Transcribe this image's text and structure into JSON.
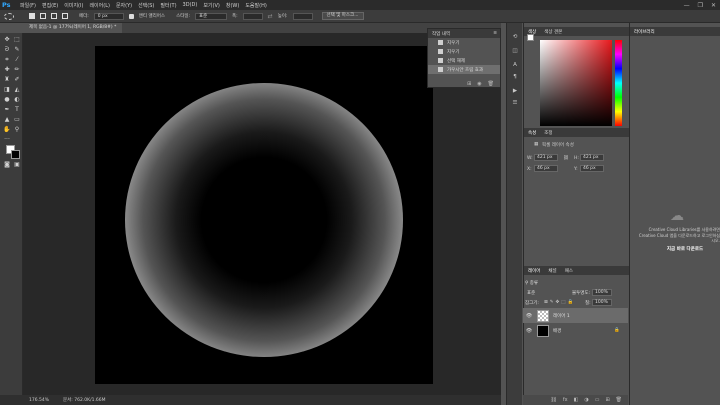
{
  "app": {
    "logo": "Ps"
  },
  "menu": [
    "파일(F)",
    "편집(E)",
    "이미지(I)",
    "레이어(L)",
    "문자(Y)",
    "선택(S)",
    "필터(T)",
    "3D(D)",
    "보기(V)",
    "창(W)",
    "도움말(H)"
  ],
  "window_controls": [
    "—",
    "❐",
    "✕"
  ],
  "options": {
    "feather_label": "페더:",
    "feather_value": "0 px",
    "antialias_label": "앤티 앨리어스",
    "style_label": "스타일:",
    "style_value": "표준",
    "width_label": "폭:",
    "height_label": "높이:",
    "select_mask_label": "선택 및 마스크..."
  },
  "document": {
    "tab_label": "제목 없음-1 @ 177%(레이어 1, RGB/8#) *",
    "zoom": "176.54%",
    "doc_info": "문서: 762.0K/1.66M"
  },
  "history": {
    "title": "작업 내역",
    "items": [
      {
        "label": "지우기",
        "selected": false
      },
      {
        "label": "지우기",
        "selected": false
      },
      {
        "label": "선택 해제",
        "selected": false
      },
      {
        "label": "가우시안 흐림 효과",
        "selected": true
      }
    ]
  },
  "color_panel": {
    "tabs": [
      "색상",
      "색상 견본"
    ]
  },
  "properties_panel": {
    "tabs": [
      "속성",
      "조정"
    ],
    "subtitle": "픽셀 레이어 속성",
    "w_label": "W:",
    "w_value": "421 px",
    "h_label": "H:",
    "h_value": "421 px",
    "x_label": "X:",
    "x_value": "46 px",
    "y_label": "Y:",
    "y_value": "46 px",
    "link_icon": "link-icon"
  },
  "libraries_panel": {
    "title": "라이브러리",
    "message": "Creative Cloud Libraries를 사용하려면 Creative Cloud 앱을 다운로드하고 로그인하십시오.",
    "download_link": "지금 바로 다운로드"
  },
  "layers_panel": {
    "tabs": [
      "레이어",
      "채널",
      "패스"
    ],
    "filter_label": "종류",
    "blend_mode": "표준",
    "opacity_label": "불투명도:",
    "opacity_value": "100%",
    "lock_label": "잠그기:",
    "fill_label": "칠:",
    "fill_value": "100%",
    "layers": [
      {
        "name": "레이어 1",
        "selected": true
      },
      {
        "name": "배경",
        "selected": false
      }
    ]
  }
}
